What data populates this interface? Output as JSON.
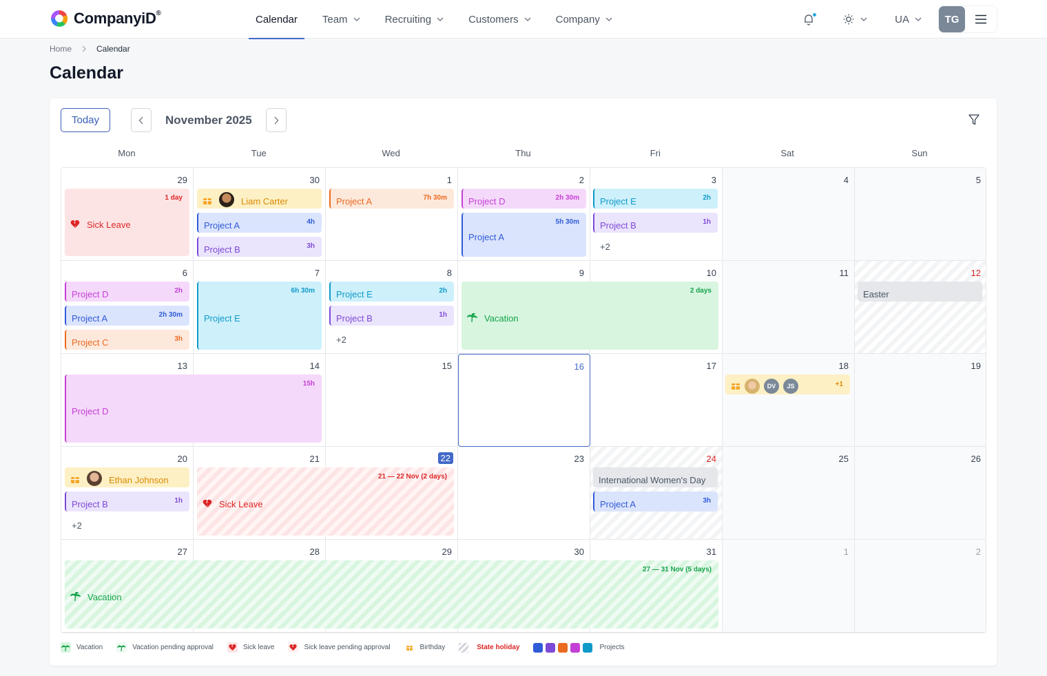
{
  "header": {
    "logo_text": "CompanyiD",
    "logo_reg": "®",
    "nav": [
      {
        "label": "Calendar",
        "active": true,
        "dropdown": false
      },
      {
        "label": "Team",
        "active": false,
        "dropdown": true
      },
      {
        "label": "Recruiting",
        "active": false,
        "dropdown": true
      },
      {
        "label": "Customers",
        "active": false,
        "dropdown": true
      },
      {
        "label": "Company",
        "active": false,
        "dropdown": true
      }
    ],
    "lang": "UA",
    "user_initials": "TG",
    "icons": {
      "notifications": "bell-icon",
      "theme": "sun-icon",
      "menu": "hamburger-icon"
    }
  },
  "breadcrumb": {
    "home": "Home",
    "current": "Calendar"
  },
  "page_title": "Calendar",
  "toolbar": {
    "today": "Today",
    "month": "November 2025"
  },
  "weekdays": [
    "Mon",
    "Tue",
    "Wed",
    "Thu",
    "Fri",
    "Sat",
    "Sun"
  ],
  "weeks": [
    [
      {
        "day": "29",
        "muted": false
      },
      {
        "day": "30"
      },
      {
        "day": "1"
      },
      {
        "day": "2"
      },
      {
        "day": "3"
      },
      {
        "day": "4"
      },
      {
        "day": "5"
      }
    ],
    [
      {
        "day": "6"
      },
      {
        "day": "7"
      },
      {
        "day": "8"
      },
      {
        "day": "9"
      },
      {
        "day": "10"
      },
      {
        "day": "11"
      },
      {
        "day": "12",
        "red": true,
        "holiday": true
      }
    ],
    [
      {
        "day": "13"
      },
      {
        "day": "14"
      },
      {
        "day": "15"
      },
      {
        "day": "16",
        "today": true
      },
      {
        "day": "17"
      },
      {
        "day": "18"
      },
      {
        "day": "19"
      }
    ],
    [
      {
        "day": "20"
      },
      {
        "day": "21"
      },
      {
        "day": "22",
        "badge": true
      },
      {
        "day": "23"
      },
      {
        "day": "24",
        "red": true,
        "holiday": true
      },
      {
        "day": "25"
      },
      {
        "day": "26"
      }
    ],
    [
      {
        "day": "27"
      },
      {
        "day": "28"
      },
      {
        "day": "29"
      },
      {
        "day": "30"
      },
      {
        "day": "31"
      },
      {
        "day": "1",
        "muted": true
      },
      {
        "day": "2",
        "muted": true
      }
    ]
  ],
  "events": {
    "w0": {
      "sick": {
        "title": "Sick Leave",
        "dur": "1 day"
      },
      "bday_tue": {
        "name": "Liam Carter"
      },
      "tue_a": {
        "title": "Project A",
        "dur": "4h"
      },
      "tue_b": {
        "title": "Project  B",
        "dur": "3h"
      },
      "wed_a": {
        "title": "Project A",
        "dur": "7h 30m"
      },
      "thu_d": {
        "title": "Project D",
        "dur": "2h 30m"
      },
      "thu_a": {
        "title": "Project A",
        "dur": "5h 30m"
      },
      "fri_e": {
        "title": "Project E",
        "dur": "2h"
      },
      "fri_b": {
        "title": "Project B",
        "dur": "1h"
      },
      "fri_more": "+2"
    },
    "w1": {
      "mon_d": {
        "title": "Project D",
        "dur": "2h"
      },
      "mon_a": {
        "title": "Project A",
        "dur": "2h 30m"
      },
      "mon_c": {
        "title": "Project C",
        "dur": "3h"
      },
      "tue_e": {
        "title": "Project E",
        "dur": "6h 30m"
      },
      "wed_e": {
        "title": "Project E",
        "dur": "2h"
      },
      "wed_b": {
        "title": "Project B",
        "dur": "1h"
      },
      "wed_more": "+2",
      "vac": {
        "title": "Vacation",
        "dur": "2 days"
      },
      "easter": {
        "title": "Easter"
      }
    },
    "w2": {
      "proj_d": {
        "title": "Project D",
        "dur": "15h"
      },
      "sat_bday": {
        "a1": "DV",
        "a2": "JS",
        "more": "+1"
      }
    },
    "w3": {
      "bday_mon": {
        "name": "Ethan Johnson"
      },
      "mon_b": {
        "title": "Project B",
        "dur": "1h"
      },
      "mon_more": "+2",
      "sick": {
        "title": "Sick Leave",
        "dur": "21 —  22 Nov (2 days)"
      },
      "iwd": {
        "title": "International Women's Day"
      },
      "fri_a": {
        "title": "Project A",
        "dur": "3h"
      }
    },
    "w4": {
      "vac": {
        "title": "Vacation",
        "dur": "27 —  31 Nov (5 days)"
      }
    }
  },
  "legend": {
    "vacation": "Vacation",
    "vacation_pending": "Vacation pending approval",
    "sick": "Sick leave",
    "sick_pending": "Sick leave pending approval",
    "birthday": "Birthday",
    "state_holiday": "State holiday",
    "projects": "Projects",
    "project_colors": [
      "#2f5bd7",
      "#7c4ad6",
      "#ea6a20",
      "#c43fd6",
      "#0f9ac8"
    ]
  },
  "colors": {
    "accent": "#4169c8",
    "sick": "#dc2626",
    "vacation": "#16a34a",
    "birthday": "#d98a06"
  }
}
